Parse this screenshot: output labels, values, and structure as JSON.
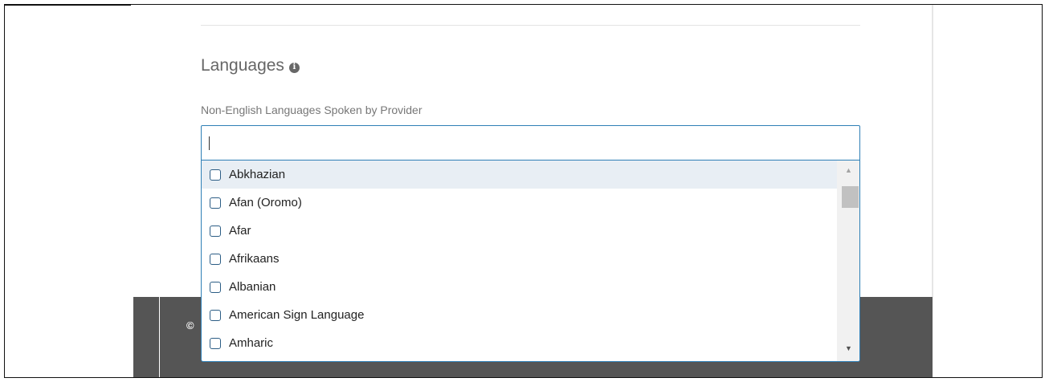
{
  "section": {
    "title": "Languages",
    "info_icon": "info-circle-icon"
  },
  "field": {
    "label": "Non-English Languages Spoken by Provider",
    "search_value": ""
  },
  "dropdown": {
    "options": [
      {
        "label": "Abkhazian",
        "checked": false,
        "highlighted": true
      },
      {
        "label": "Afan (Oromo)",
        "checked": false,
        "highlighted": false
      },
      {
        "label": "Afar",
        "checked": false,
        "highlighted": false
      },
      {
        "label": "Afrikaans",
        "checked": false,
        "highlighted": false
      },
      {
        "label": "Albanian",
        "checked": false,
        "highlighted": false
      },
      {
        "label": "American Sign Language",
        "checked": false,
        "highlighted": false
      },
      {
        "label": "Amharic",
        "checked": false,
        "highlighted": false
      }
    ],
    "scroll_up_icon": "▲",
    "scroll_down_icon": "▼"
  },
  "footer": {
    "copyright_symbol": "©"
  },
  "colors": {
    "focus_border": "#2e7fb6",
    "highlight_bg": "#e8eef4",
    "checkbox_border": "#2c5d85",
    "footer_bg": "#555555"
  }
}
